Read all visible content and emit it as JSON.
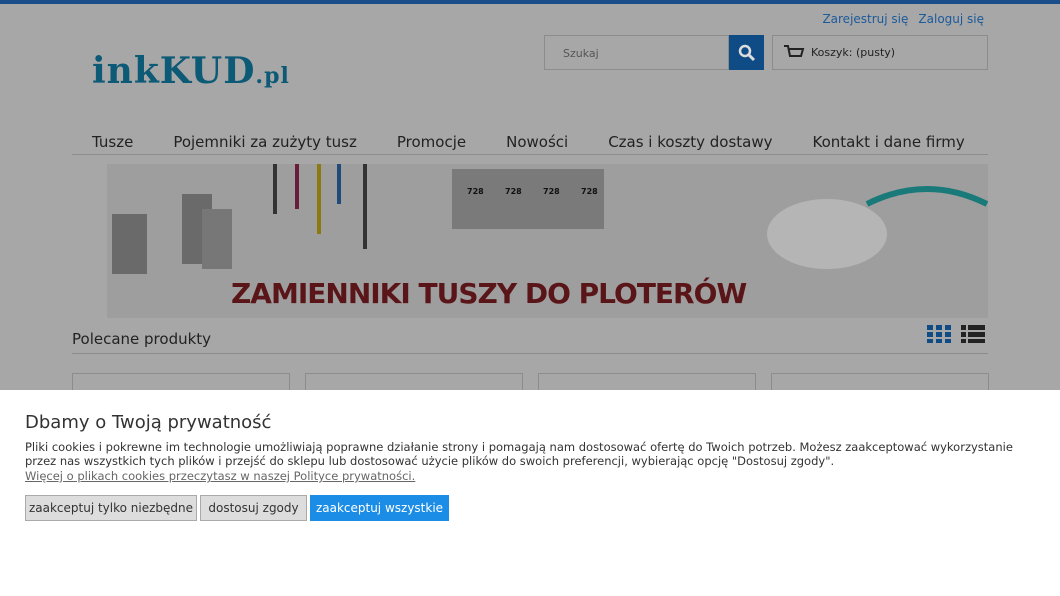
{
  "header": {
    "register": "Zarejestruj się",
    "login": "Zaloguj się",
    "logo_main": "inkKUD",
    "logo_tld": ".pl",
    "search_placeholder": "Szukaj",
    "cart_label": "Koszyk: (pusty)"
  },
  "nav": {
    "items": [
      "Tusze",
      "Pojemniki za zużyty tusz",
      "Promocje",
      "Nowości",
      "Czas i koszty dostawy",
      "Kontakt i dane firmy"
    ]
  },
  "banner": {
    "title": "ZAMIENNIKI TUSZY DO PLOTERÓW",
    "cartridge_labels": [
      "728",
      "728",
      "728",
      "728"
    ]
  },
  "section": {
    "title": "Polecane produkty"
  },
  "cookie": {
    "title": "Dbamy o Twoją prywatność",
    "text": "Pliki cookies i pokrewne im technologie umożliwiają poprawne działanie strony i pomagają nam dostosować ofertę do Twoich potrzeb. Możesz zaakceptować wykorzystanie przez nas wszystkich tych plików i przejść do sklepu lub dostosować użycie plików do swoich preferencji, wybierając opcję \"Dostosuj zgody\".",
    "link": "Więcej o plikach cookies przeczytasz w naszej Polityce prywatności.",
    "btn_necessary": "zaakceptuj tylko niezbędne",
    "btn_customize": "dostosuj zgody",
    "btn_all": "zaakceptuj wszystkie"
  },
  "colors": {
    "accent": "#1b8de6",
    "nav_blue": "#0f4b84"
  }
}
